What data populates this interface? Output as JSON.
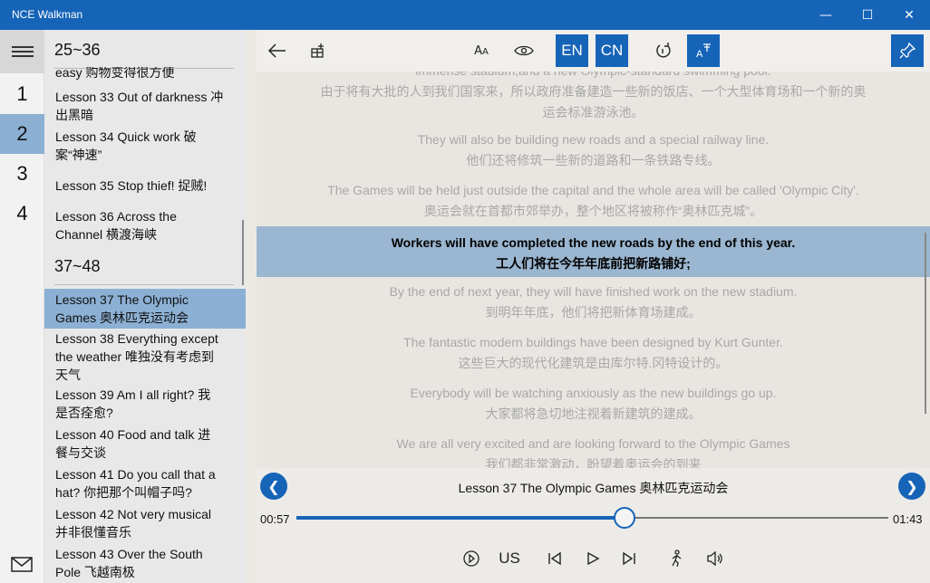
{
  "window": {
    "title": "NCE Walkman"
  },
  "rail": {
    "items": [
      {
        "label": "1",
        "selected": false
      },
      {
        "label": "2",
        "selected": true
      },
      {
        "label": "3",
        "selected": false
      },
      {
        "label": "4",
        "selected": false
      }
    ]
  },
  "list": {
    "group1": "25~36",
    "group2": "37~48",
    "items": [
      {
        "lines": [
          "easy 购物变得很方便"
        ]
      },
      {
        "lines": [
          "Lesson 33  Out of darkness 冲",
          "出黑暗"
        ]
      },
      {
        "lines": [
          "Lesson 34  Quick work 破",
          "案“神速”"
        ]
      },
      {
        "lines": [
          "Lesson 35  Stop thief! 捉贼!"
        ]
      },
      {
        "lines": [
          "Lesson 36  Across the",
          "Channel 横渡海峡"
        ]
      },
      {
        "lines": [
          "Lesson 37  The Olympic",
          "Games 奥林匹克运动会"
        ],
        "selected": true
      },
      {
        "lines": [
          "Lesson 38  Everything except",
          "the weather 唯独没有考虑到",
          "天气"
        ]
      },
      {
        "lines": [
          "Lesson 39  Am I all right? 我",
          "是否痊愈?"
        ]
      },
      {
        "lines": [
          "Lesson 40  Food and talk 进",
          "餐与交谈"
        ]
      },
      {
        "lines": [
          "Lesson 41  Do you call that a",
          "hat? 你把那个叫帽子吗?"
        ]
      },
      {
        "lines": [
          "Lesson 42  Not very musical",
          "并非很懂音乐"
        ]
      },
      {
        "lines": [
          "Lesson 43  Over the South",
          "Pole 飞越南极"
        ]
      }
    ]
  },
  "toolbar": {
    "en": "EN",
    "cn": "CN"
  },
  "reader": {
    "paragraphs": [
      {
        "en": "immense stadium,and a new Olympic-standard swimming pool.",
        "cn": "由于将有大批的人到我们国家来，所以政府准备建造一些新的饭店、一个大型体育场和一个新的奥",
        "cn2": "运会标准游泳池。"
      },
      {
        "en": "They will also be building new roads and a special railway line.",
        "cn": "他们还将修筑一些新的道路和一条铁路专线。"
      },
      {
        "en": "The Games will be held just outside the capital and the whole area will be called 'Olympic City'.",
        "cn": "奥运会就在首都市郊举办，整个地区将被称作“奥林匹克城”。"
      },
      {
        "en": "Workers will have completed the new roads by the end of this year.",
        "cn": "工人们将在今年年底前把新路铺好;",
        "current": true
      },
      {
        "en": "By the end of next year, they will have finished work on the new stadium.",
        "cn": "到明年年底，他们将把新体育场建成。"
      },
      {
        "en": "The fantastic modern buildings have been designed by Kurt Gunter.",
        "cn": "这些巨大的现代化建筑是由库尔特.冈特设计的。"
      },
      {
        "en": "Everybody will be watching anxiously as the new buildings go up.",
        "cn": "大家都将急切地注视着新建筑的建成。"
      },
      {
        "en": "We are all very excited and are looking forward to the Olympic Games",
        "cn": "我们都非常激动，盼望着奥运会的到来"
      }
    ]
  },
  "player": {
    "now_playing": "Lesson 37  The Olympic Games 奥林匹克运动会",
    "elapsed": "00:57",
    "duration": "01:43",
    "progress": 0.555,
    "accent": "US"
  },
  "colors": {
    "accent": "#1664b8",
    "selection": "#8cb0d4"
  }
}
